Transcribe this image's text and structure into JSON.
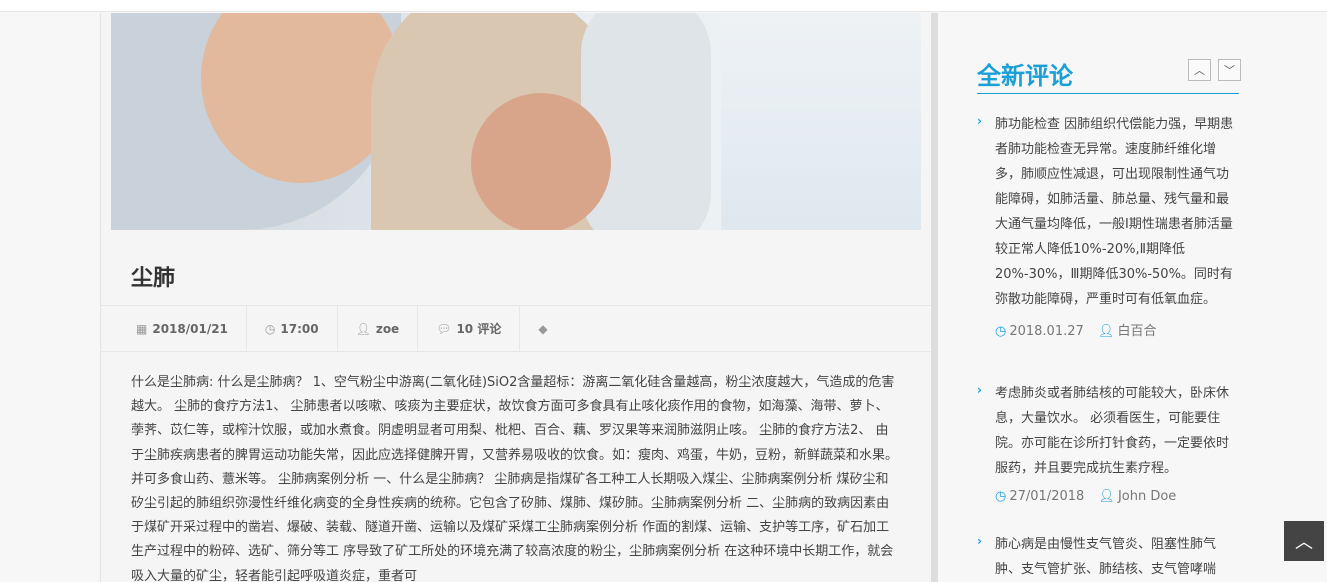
{
  "article": {
    "title": "尘肺",
    "meta": {
      "date": "2018/01/21",
      "time": "17:00",
      "author": "zoe",
      "comments": "10 评论"
    },
    "body": "什么是尘肺病: 什么是尘肺病？ 1、空气粉尘中游离(二氧化硅)SiO2含量超标：游离二氧化硅含量越高，粉尘浓度越大，气造成的危害越大。 尘肺的食疗方法1、 尘肺患者以咳嗽、咳痰为主要症状，故饮食方面可多食具有止咳化痰作用的食物，如海藻、海带、萝卜、荸荠、苡仁等，或榨汁饮服，或加水煮食。阴虚明显者可用梨、枇杷、百合、藕、罗汉果等来润肺滋阴止咳。 尘肺的食疗方法2、 由于尘肺疾病患者的脾胃运动功能失常，因此应选择健脾开胃，又营养易吸收的饮食。如：瘦肉、鸡蛋，牛奶，豆粉，新鲜蔬菜和水果。并可多食山药、薏米等。 尘肺病案例分析 一、什么是尘肺病？ 尘肺病是指煤矿各工种工人长期吸入煤尘、尘肺病案例分析 煤矽尘和矽尘引起的肺组织弥漫性纤维化病变的全身性疾病的统称。它包含了矽肺、煤肺、煤矽肺。尘肺病案例分析 二、尘肺病的致病因素由于煤矿开采过程中的凿岩、爆破、装载、隧道开凿、运输以及煤矿采煤工尘肺病案例分析 作面的割煤、运输、支护等工序，矿石加工生产过程中的粉碎、选矿、筛分等工 序导致了矿工所处的环境充满了较高浓度的粉尘，尘肺病案例分析 在这种环境中长期工作，就会吸入大量的矿尘，轻者能引起呼吸道炎症，重者可"
  },
  "sidebar": {
    "title": "全新评论",
    "comments": [
      {
        "text": "肺功能检查 因肺组织代偿能力强，早期患者肺功能检查无异常。速度肺纤维化增多，肺顺应性减退，可出现限制性通气功能障碍，如肺活量、肺总量、残气量和最大通气量均降低，一般Ⅰ期性瑞患者肺活量较正常人降低10%-20%,Ⅱ期降低 20%-30%，Ⅲ期降低30%-50%。同时有弥散功能障碍，严重时可有低氧血症。",
        "date": "2018.01.27",
        "author": "白百合"
      },
      {
        "text": "考虑肺炎或者肺结核的可能较大，卧床休息，大量饮水。 必须看医生，可能要住院。亦可能在诊所打针食药，一定要依时服药，并且要完成抗生素疗程。",
        "date": "27/01/2018",
        "author": "John Doe"
      },
      {
        "text": "肺心病是由慢性支气管炎、阻塞性肺气肿、支气管扩张、肺结核、支气管哮喘",
        "date": "",
        "author": ""
      }
    ]
  },
  "colors": {
    "accent": "#1a9fd6"
  }
}
